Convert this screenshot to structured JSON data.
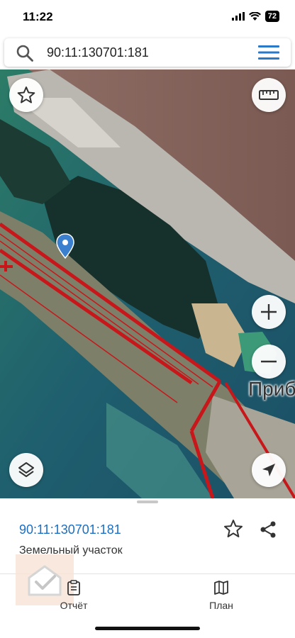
{
  "status_bar": {
    "time": "11:22",
    "battery": "72"
  },
  "search": {
    "query": "90:11:130701:181",
    "icon": "search-icon",
    "menu_icon": "menu-icon"
  },
  "map": {
    "place_label": "Приб",
    "buttons": {
      "favorite": "star-icon",
      "ruler": "ruler-icon",
      "zoom_in": "plus-icon",
      "zoom_out": "minus-icon",
      "layers": "layers-icon",
      "locate": "navigation-arrow-icon"
    },
    "colors": {
      "boundary": "#c8171b",
      "marker": "#3b7fcf"
    }
  },
  "sheet": {
    "cadastral_number": "90:11:130701:181",
    "object_type": "Земельный участок",
    "colors": {
      "link": "#1a6fc4"
    }
  },
  "tabs": [
    {
      "label": "Отчёт",
      "icon": "clipboard-icon"
    },
    {
      "label": "План",
      "icon": "map-icon"
    }
  ]
}
